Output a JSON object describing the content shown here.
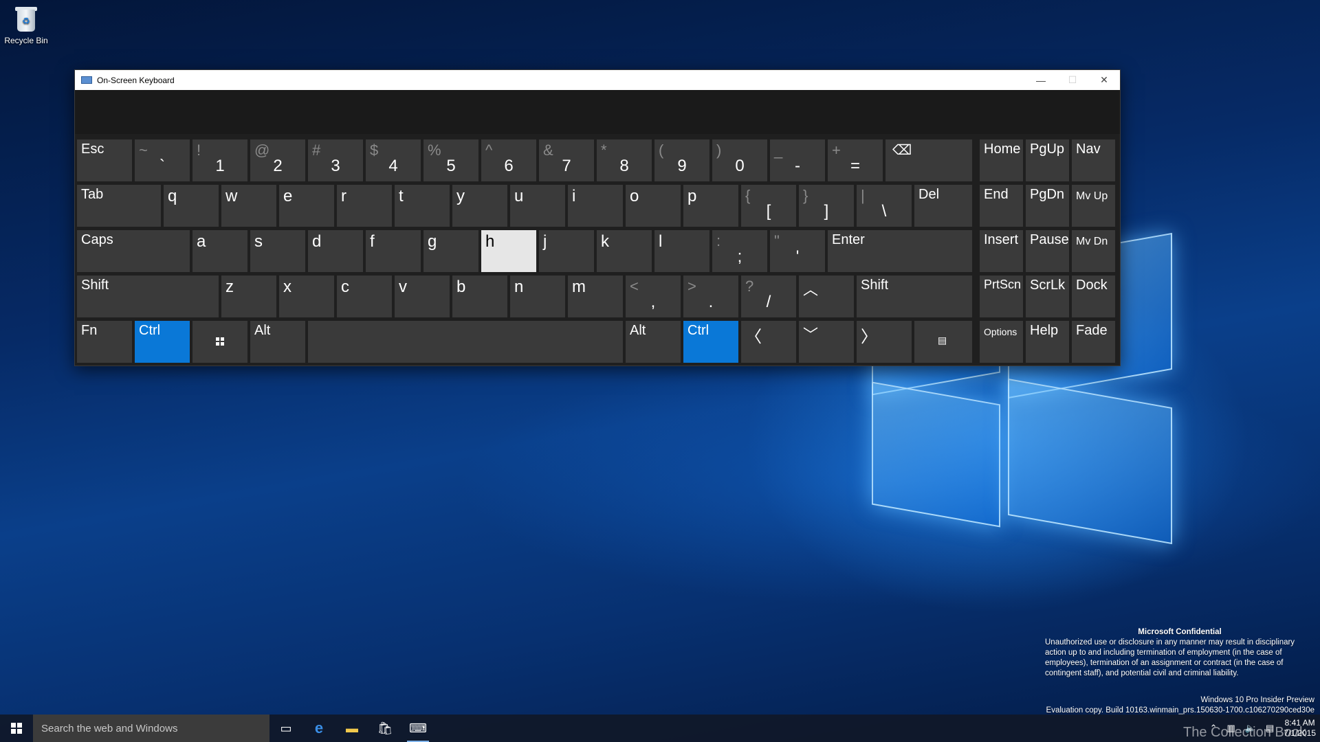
{
  "desktop": {
    "recycle_bin_label": "Recycle Bin"
  },
  "window": {
    "title": "On-Screen Keyboard",
    "minimize": "—",
    "maximize": "☐",
    "close": "✕"
  },
  "keys": {
    "esc": "Esc",
    "backtick_shift": "~",
    "backtick": "`",
    "k1s": "!",
    "k1": "1",
    "k2s": "@",
    "k2": "2",
    "k3s": "#",
    "k3": "3",
    "k4s": "$",
    "k4": "4",
    "k5s": "%",
    "k5": "5",
    "k6s": "^",
    "k6": "6",
    "k7s": "&",
    "k7": "7",
    "k8s": "*",
    "k8": "8",
    "k9s": "(",
    "k9": "9",
    "k0s": ")",
    "k0": "0",
    "minus_s": "_",
    "minus": "-",
    "eq_s": "+",
    "eq": "=",
    "backspace": "⌫",
    "home": "Home",
    "pgup": "PgUp",
    "nav": "Nav",
    "tab": "Tab",
    "q": "q",
    "w": "w",
    "e": "e",
    "r": "r",
    "t": "t",
    "y": "y",
    "u": "u",
    "i": "i",
    "o": "o",
    "p": "p",
    "lbr_s": "{",
    "lbr": "[",
    "rbr_s": "}",
    "rbr": "]",
    "bsl_s": "|",
    "bsl": "\\",
    "del": "Del",
    "end": "End",
    "pgdn": "PgDn",
    "mvup": "Mv Up",
    "caps": "Caps",
    "a": "a",
    "s": "s",
    "d": "d",
    "f": "f",
    "g": "g",
    "h": "h",
    "j": "j",
    "k": "k",
    "l": "l",
    "semi_s": ":",
    "semi": ";",
    "quote_s": "\"",
    "quote": "'",
    "enter": "Enter",
    "insert": "Insert",
    "pause": "Pause",
    "mvdn": "Mv Dn",
    "shift_l": "Shift",
    "z": "z",
    "x": "x",
    "c": "c",
    "v": "v",
    "b": "b",
    "n": "n",
    "m": "m",
    "comma_s": "<",
    "comma": ",",
    "period_s": ">",
    "period": ".",
    "slash_s": "?",
    "slash": "/",
    "up": "︿",
    "shift_r": "Shift",
    "prtscn": "PrtScn",
    "scrlk": "ScrLk",
    "dock": "Dock",
    "fn": "Fn",
    "ctrl_l": "Ctrl",
    "alt_l": "Alt",
    "alt_r": "Alt",
    "ctrl_r": "Ctrl",
    "left": "〈",
    "down": "﹀",
    "right": "〉",
    "menu": "▤",
    "options": "Options",
    "help": "Help",
    "fade": "Fade"
  },
  "colors": {
    "modifier_active": "#0a78d7",
    "pressed_key": "#e6e6e6",
    "key_bg": "#3a3a3a"
  },
  "taskbar": {
    "search_placeholder": "Search the web and Windows",
    "clock_time": "8:41 AM",
    "clock_date": "7/1/2015",
    "icons": [
      "task-view-icon",
      "edge-icon",
      "file-explorer-icon",
      "store-icon",
      "on-screen-keyboard-icon"
    ]
  },
  "watermark": {
    "title": "Microsoft Confidential",
    "body": "Unauthorized use or disclosure in any manner may result in disciplinary action up to and including termination of employment (in the case of employees), termination of an assignment or contract (in the case of contingent staff), and potential civil and criminal liability.",
    "edition": "Windows 10 Pro Insider Preview",
    "build": "Evaluation copy. Build 10163.winmain_prs.150630-1700.c106270290ced30e"
  },
  "overlay_brand": "The Collection Book"
}
